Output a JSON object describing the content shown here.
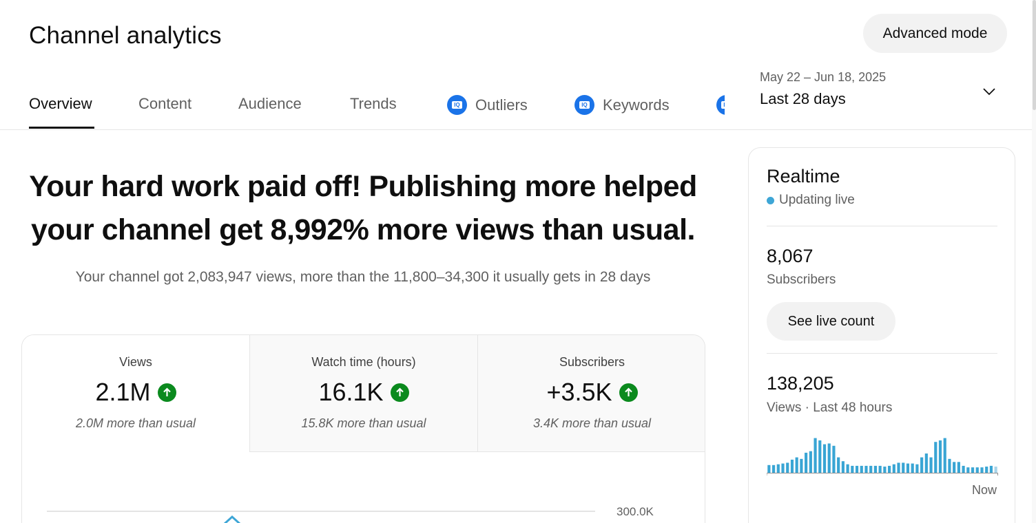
{
  "header": {
    "title": "Channel analytics",
    "advanced_mode_label": "Advanced mode"
  },
  "tabs": [
    {
      "label": "Overview",
      "active": true
    },
    {
      "label": "Content",
      "active": false
    },
    {
      "label": "Audience",
      "active": false
    },
    {
      "label": "Trends",
      "active": false
    },
    {
      "label": "Outliers",
      "active": false,
      "icon": "extension-icon"
    },
    {
      "label": "Keywords",
      "active": false,
      "icon": "extension-icon"
    }
  ],
  "date_range": {
    "dates": "May 22 – Jun 18, 2025",
    "period": "Last 28 days"
  },
  "insight": {
    "headline": "Your hard work paid off! Publishing more helped your channel get 8,992% more views than usual.",
    "detail": "Your channel got 2,083,947 views, more than the 11,800–34,300 it usually gets in 28 days"
  },
  "metrics": [
    {
      "label": "Views",
      "value": "2.1M",
      "trend": "up",
      "note": "2.0M more than usual"
    },
    {
      "label": "Watch time (hours)",
      "value": "16.1K",
      "trend": "up",
      "note": "15.8K more than usual"
    },
    {
      "label": "Subscribers",
      "value": "+3.5K",
      "trend": "up",
      "note": "3.4K more than usual"
    }
  ],
  "views_chart": {
    "y_tick_top": "300.0K"
  },
  "realtime": {
    "title": "Realtime",
    "status": "Updating live",
    "subscribers_value": "8,067",
    "subscribers_label": "Subscribers",
    "see_live_label": "See live count",
    "views_value": "138,205",
    "views_label": "Views · Last 48 hours",
    "now_label": "Now"
  },
  "chart_data": {
    "type": "bar",
    "title": "",
    "xlabel": "",
    "ylabel": "",
    "x_end_label": "Now",
    "values": [
      10,
      10,
      11,
      12,
      13,
      17,
      20,
      18,
      26,
      28,
      45,
      42,
      37,
      38,
      35,
      20,
      15,
      11,
      9,
      9,
      9,
      9,
      9,
      9,
      9,
      8,
      9,
      11,
      13,
      13,
      12,
      12,
      11,
      20,
      25,
      20,
      40,
      42,
      45,
      18,
      14,
      14,
      9,
      7,
      7,
      7,
      7,
      8,
      9,
      8
    ],
    "ylim": [
      0,
      50
    ],
    "colors": {
      "bar": "#39a5d4",
      "current_bar": "#a8d3e8"
    }
  },
  "colors": {
    "accent_blue": "#1a73e8",
    "trend_up": "#0b8a1e",
    "live_dot": "#3ea6d6"
  }
}
